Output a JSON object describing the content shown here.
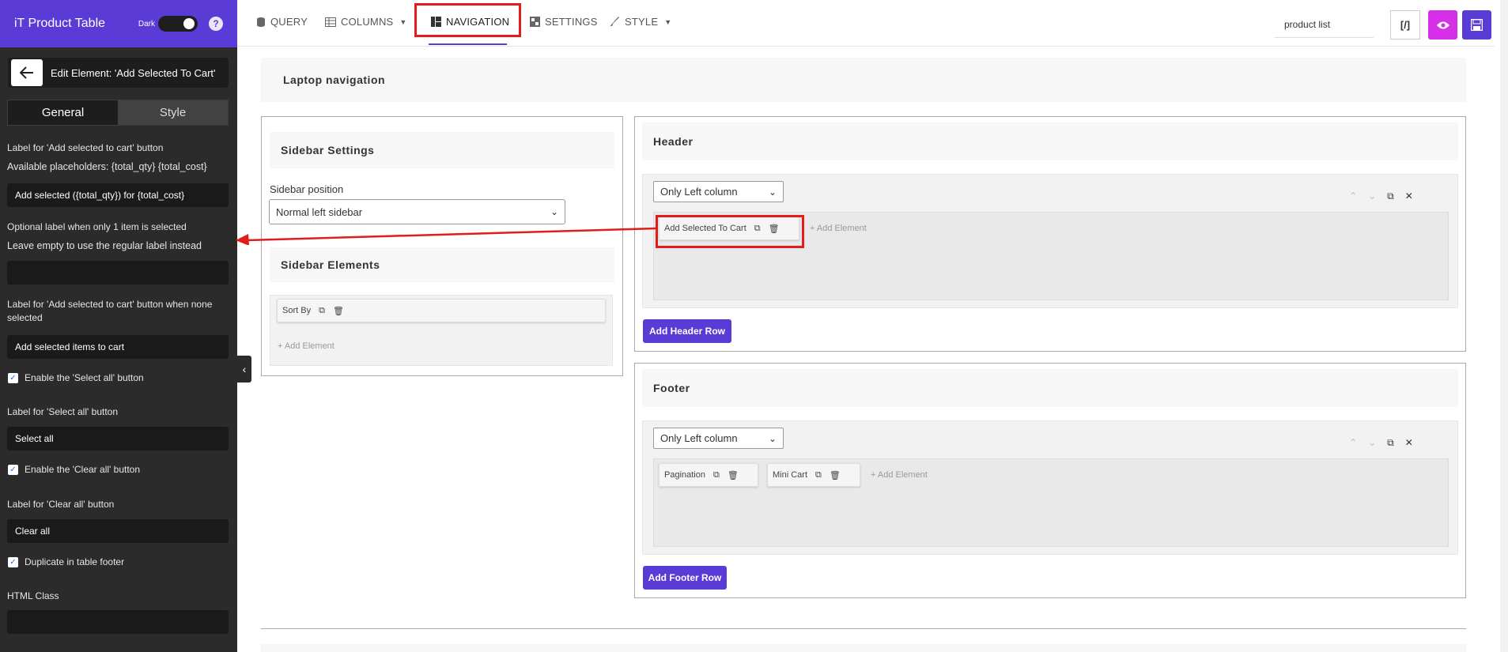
{
  "sidebar": {
    "title": "iT Product Table",
    "dark_label": "Dark",
    "help": "?",
    "edit_title": "Edit Element: 'Add Selected To Cart'",
    "tabs": [
      "General",
      "Style"
    ],
    "fields": {
      "label_add_selected": "Label for 'Add selected to cart' button",
      "placeholders": "Available placeholders: {total_qty} {total_cost}",
      "value_add_selected": "Add selected ({total_qty}) for {total_cost}",
      "optional_label_1": "Optional label when only 1 item is selected",
      "optional_label_2": "Leave empty to use the regular label instead",
      "value_optional": "",
      "label_none_selected": "Label for 'Add selected to cart' button when none selected",
      "value_none_selected": "Add selected items to cart",
      "enable_select_all": "Enable the 'Select all' button",
      "label_select_all": "Label for 'Select all' button",
      "value_select_all": "Select all",
      "enable_clear_all": "Enable the 'Clear all' button",
      "label_clear_all": "Label for 'Clear all' button",
      "value_clear_all": "Clear all",
      "duplicate_footer": "Duplicate in table footer",
      "html_class": "HTML Class",
      "value_html_class": ""
    }
  },
  "topnav": {
    "query": "QUERY",
    "columns": "COLUMNS",
    "navigation": "NAVIGATION",
    "settings": "SETTINGS",
    "style": "STYLE",
    "search_value": "product list",
    "code_label": "[/]"
  },
  "main": {
    "laptop_nav": "Laptop navigation",
    "sidebar_settings": "Sidebar Settings",
    "sidebar_position_label": "Sidebar position",
    "sidebar_position_value": "Normal left sidebar",
    "sidebar_elements": "Sidebar Elements",
    "sort_by": "Sort By",
    "add_element": "+ Add Element",
    "header": "Header",
    "header_columns": "Only Left column",
    "add_selected_chip": "Add Selected To Cart",
    "add_header_row": "Add Header Row",
    "footer": "Footer",
    "footer_columns": "Only Left column",
    "pagination": "Pagination",
    "mini_cart": "Mini Cart",
    "add_footer_row": "Add Footer Row"
  },
  "colors": {
    "accent": "#5a3bd6",
    "preview": "#d530e8",
    "highlight": "#e21b1b",
    "panel": "#2b2b2b"
  }
}
